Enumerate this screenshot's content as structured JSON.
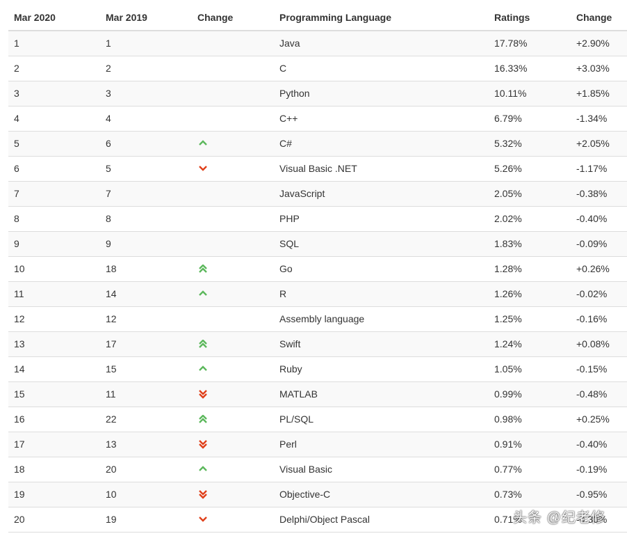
{
  "headers": [
    "Mar 2020",
    "Mar 2019",
    "Change",
    "Programming Language",
    "Ratings",
    "Change"
  ],
  "colors": {
    "up": "#5cb85c",
    "down": "#e0401a"
  },
  "rows": [
    [
      "1",
      "1",
      "",
      "Java",
      "17.78%",
      "+2.90%"
    ],
    [
      "2",
      "2",
      "",
      "C",
      "16.33%",
      "+3.03%"
    ],
    [
      "3",
      "3",
      "",
      "Python",
      "10.11%",
      "+1.85%"
    ],
    [
      "4",
      "4",
      "",
      "C++",
      "6.79%",
      "-1.34%"
    ],
    [
      "5",
      "6",
      "up",
      "C#",
      "5.32%",
      "+2.05%"
    ],
    [
      "6",
      "5",
      "down",
      "Visual Basic .NET",
      "5.26%",
      "-1.17%"
    ],
    [
      "7",
      "7",
      "",
      "JavaScript",
      "2.05%",
      "-0.38%"
    ],
    [
      "8",
      "8",
      "",
      "PHP",
      "2.02%",
      "-0.40%"
    ],
    [
      "9",
      "9",
      "",
      "SQL",
      "1.83%",
      "-0.09%"
    ],
    [
      "10",
      "18",
      "up-double",
      "Go",
      "1.28%",
      "+0.26%"
    ],
    [
      "11",
      "14",
      "up",
      "R",
      "1.26%",
      "-0.02%"
    ],
    [
      "12",
      "12",
      "",
      "Assembly language",
      "1.25%",
      "-0.16%"
    ],
    [
      "13",
      "17",
      "up-double",
      "Swift",
      "1.24%",
      "+0.08%"
    ],
    [
      "14",
      "15",
      "up",
      "Ruby",
      "1.05%",
      "-0.15%"
    ],
    [
      "15",
      "11",
      "down-double",
      "MATLAB",
      "0.99%",
      "-0.48%"
    ],
    [
      "16",
      "22",
      "up-double",
      "PL/SQL",
      "0.98%",
      "+0.25%"
    ],
    [
      "17",
      "13",
      "down-double",
      "Perl",
      "0.91%",
      "-0.40%"
    ],
    [
      "18",
      "20",
      "up",
      "Visual Basic",
      "0.77%",
      "-0.19%"
    ],
    [
      "19",
      "10",
      "down-double",
      "Objective-C",
      "0.73%",
      "-0.95%"
    ],
    [
      "20",
      "19",
      "down",
      "Delphi/Object Pascal",
      "0.71%",
      "-0.30%"
    ]
  ],
  "watermark": "头条 @纪老修"
}
